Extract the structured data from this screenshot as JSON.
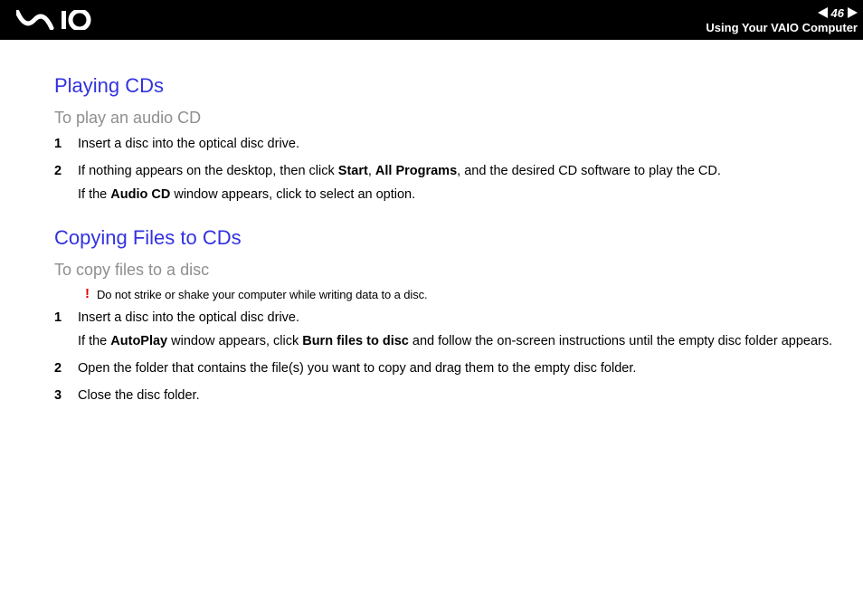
{
  "header": {
    "page_number": "46",
    "section": "Using Your VAIO Computer"
  },
  "section1": {
    "title": "Playing CDs",
    "subtitle": "To play an audio CD",
    "steps": {
      "s1": {
        "num": "1",
        "text": "Insert a disc into the optical disc drive."
      },
      "s2": {
        "num": "2",
        "pre": "If nothing appears on the desktop, then click ",
        "b1": "Start",
        "mid1": ", ",
        "b2": "All Programs",
        "post1": ", and the desired CD software to play the CD.",
        "line2_pre": "If the ",
        "line2_b": "Audio CD",
        "line2_post": " window appears, click to select an option."
      }
    }
  },
  "section2": {
    "title": "Copying Files to CDs",
    "subtitle": "To copy files to a disc",
    "warning": {
      "mark": "!",
      "text": "Do not strike or shake your computer while writing data to a disc."
    },
    "steps": {
      "s1": {
        "num": "1",
        "text": "Insert a disc into the optical disc drive.",
        "line2_pre": "If the ",
        "line2_b1": "AutoPlay",
        "line2_mid": " window appears, click ",
        "line2_b2": "Burn files to disc",
        "line2_post": " and follow the on-screen instructions until the empty disc folder appears."
      },
      "s2": {
        "num": "2",
        "text": "Open the folder that contains the file(s) you want to copy and drag them to the empty disc folder."
      },
      "s3": {
        "num": "3",
        "text": "Close the disc folder."
      }
    }
  }
}
